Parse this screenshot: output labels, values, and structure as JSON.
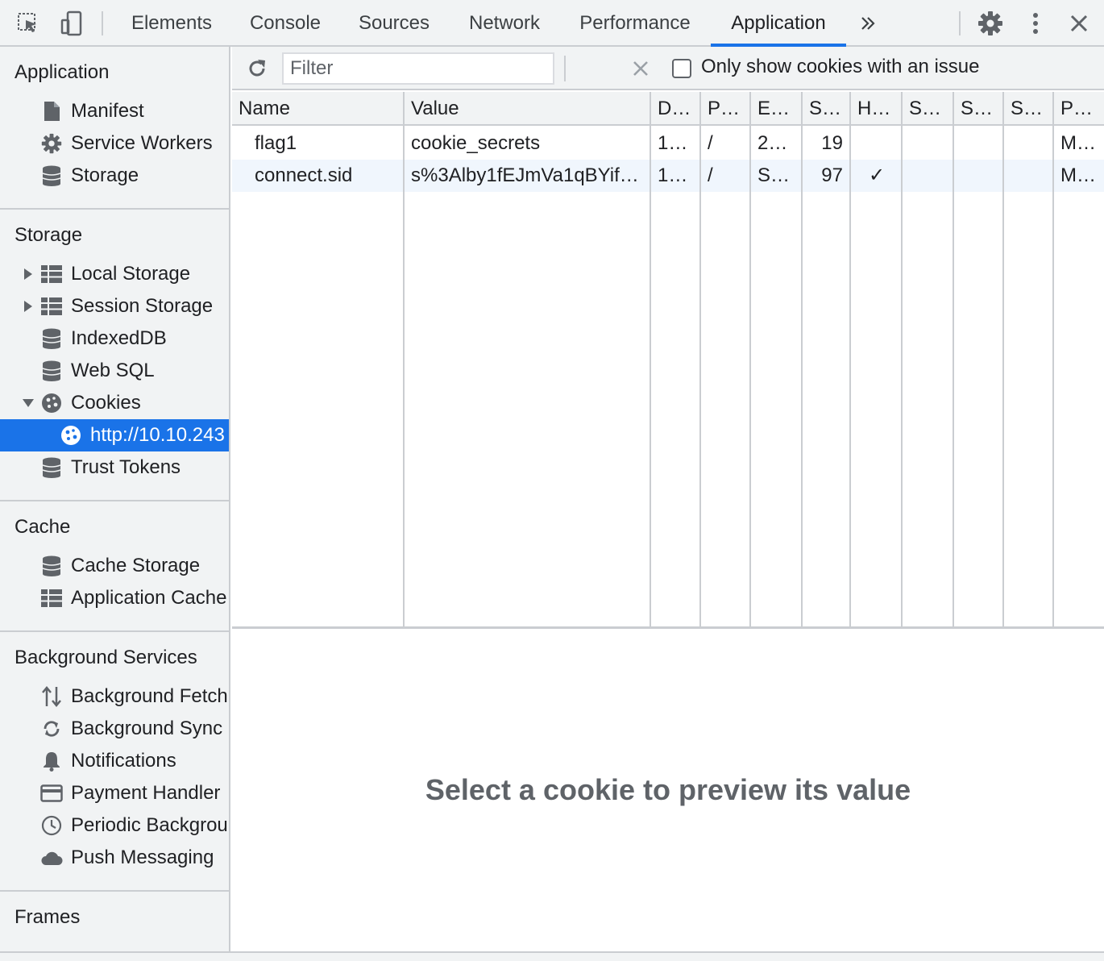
{
  "tabs": [
    "Elements",
    "Console",
    "Sources",
    "Network",
    "Performance",
    "Application"
  ],
  "active_tab": "Application",
  "more_tabs_icon": "chevron-double-right-icon",
  "sidebar": {
    "sections": [
      {
        "title": "Application",
        "items": [
          {
            "label": "Manifest",
            "icon": "document-icon"
          },
          {
            "label": "Service Workers",
            "icon": "gear-icon"
          },
          {
            "label": "Storage",
            "icon": "database-icon"
          }
        ]
      },
      {
        "title": "Storage",
        "items": [
          {
            "label": "Local Storage",
            "icon": "table-icon",
            "expandable": true
          },
          {
            "label": "Session Storage",
            "icon": "table-icon",
            "expandable": true
          },
          {
            "label": "IndexedDB",
            "icon": "database-icon"
          },
          {
            "label": "Web SQL",
            "icon": "database-icon"
          },
          {
            "label": "Cookies",
            "icon": "cookie-icon",
            "expanded": true
          },
          {
            "label": "http://10.10.243",
            "icon": "cookie-icon",
            "selected": true
          },
          {
            "label": "Trust Tokens",
            "icon": "database-icon"
          }
        ]
      },
      {
        "title": "Cache",
        "items": [
          {
            "label": "Cache Storage",
            "icon": "database-icon"
          },
          {
            "label": "Application Cache",
            "icon": "table-icon"
          }
        ]
      },
      {
        "title": "Background Services",
        "items": [
          {
            "label": "Background Fetch",
            "icon": "arrows-updown-icon"
          },
          {
            "label": "Background Sync",
            "icon": "sync-icon"
          },
          {
            "label": "Notifications",
            "icon": "bell-icon"
          },
          {
            "label": "Payment Handler",
            "icon": "card-icon"
          },
          {
            "label": "Periodic Background Sync",
            "icon": "clock-icon"
          },
          {
            "label": "Push Messaging",
            "icon": "cloud-icon"
          }
        ]
      },
      {
        "title": "Frames",
        "items": []
      }
    ]
  },
  "toolbar": {
    "filter_placeholder": "Filter",
    "checkbox_label": "Only show cookies with an issue",
    "checkbox_checked": false
  },
  "table": {
    "headers": [
      "Name",
      "Value",
      "D…",
      "P…",
      "E…",
      "S…",
      "H…",
      "S…",
      "S…",
      "S…",
      "P…"
    ],
    "rows": [
      [
        "flag1",
        "cookie_secrets",
        "1…",
        "/",
        "2…",
        "19",
        "",
        "",
        "",
        "",
        "M…"
      ],
      [
        "connect.sid",
        "s%3Alby1fEJmVa1qBYif…",
        "1…",
        "/",
        "S…",
        "97",
        "✓",
        "",
        "",
        "",
        "M…"
      ]
    ]
  },
  "preview": {
    "message": "Select a cookie to preview its value"
  },
  "colors": {
    "accent": "#1a73e8",
    "panel_bg": "#f1f3f4",
    "divider": "#cacdd1",
    "alt_row": "#f0f6fd"
  }
}
